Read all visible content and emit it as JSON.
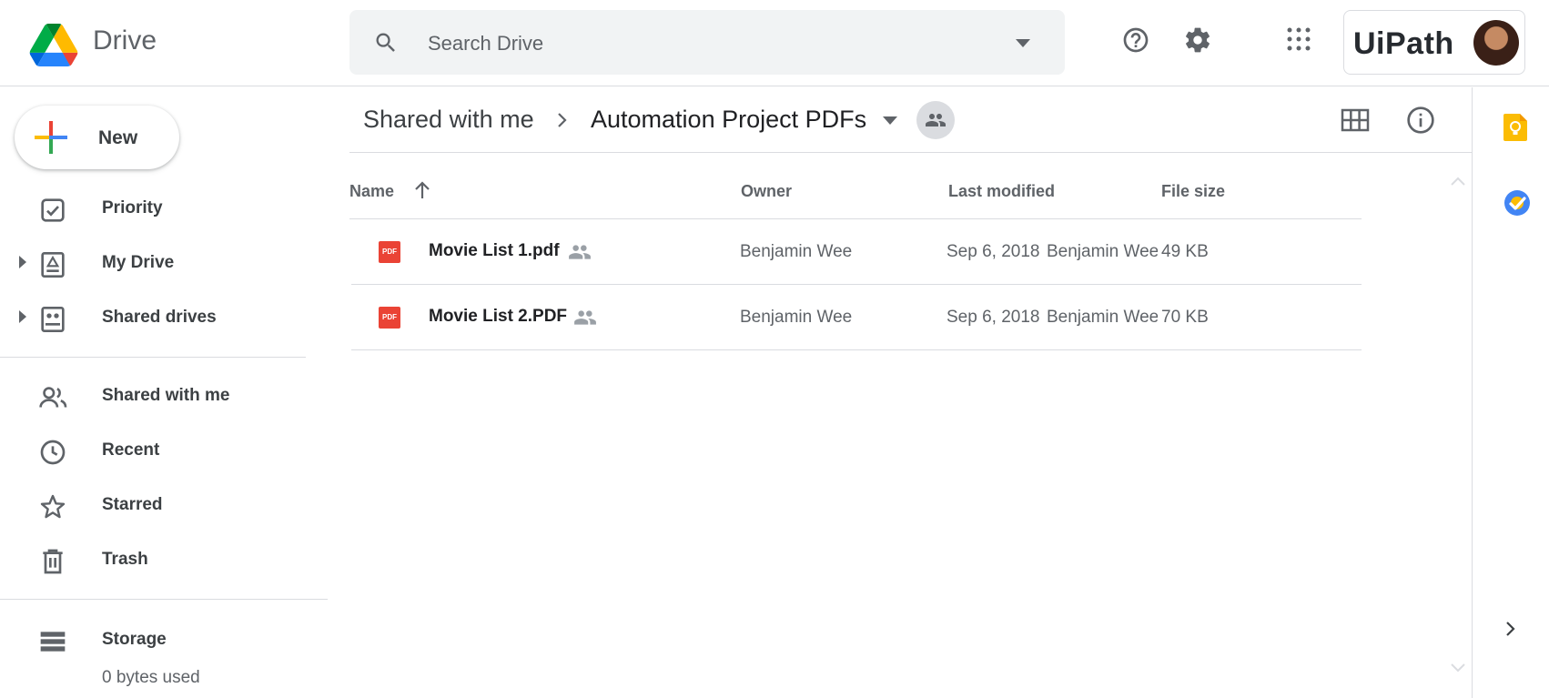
{
  "app": {
    "brand": "Drive"
  },
  "search": {
    "placeholder": "Search Drive"
  },
  "account": {
    "org_logo_text": "UiPath"
  },
  "sidebar": {
    "new_label": "New",
    "items": [
      {
        "label": "Priority",
        "icon": "priority-check-icon"
      },
      {
        "label": "My Drive",
        "icon": "my-drive-icon"
      },
      {
        "label": "Shared drives",
        "icon": "shared-drives-icon"
      },
      {
        "label": "Shared with me",
        "icon": "people-icon"
      },
      {
        "label": "Recent",
        "icon": "clock-icon"
      },
      {
        "label": "Starred",
        "icon": "star-icon"
      },
      {
        "label": "Trash",
        "icon": "trash-icon"
      },
      {
        "label": "Storage",
        "icon": "storage-icon"
      }
    ],
    "storage_used": "0 bytes used"
  },
  "breadcrumb": {
    "parent": "Shared with me",
    "current": "Automation Project PDFs"
  },
  "table": {
    "headers": {
      "name": "Name",
      "owner": "Owner",
      "modified": "Last modified",
      "size": "File size"
    },
    "rows": [
      {
        "name": "Movie List 1.pdf",
        "owner": "Benjamin Wee",
        "modified_date": "Sep 6, 2018",
        "modified_by": "Benjamin Wee",
        "size": "49 KB"
      },
      {
        "name": "Movie List 2.PDF",
        "owner": "Benjamin Wee",
        "modified_date": "Sep 6, 2018",
        "modified_by": "Benjamin Wee",
        "size": "70 KB"
      }
    ],
    "file_icon_text": "PDF"
  },
  "colors": {
    "pdf_red": "#ea4335",
    "keep_yellow": "#fbbc04",
    "tasks_blue": "#4285f4",
    "divider": "#dadce0"
  }
}
